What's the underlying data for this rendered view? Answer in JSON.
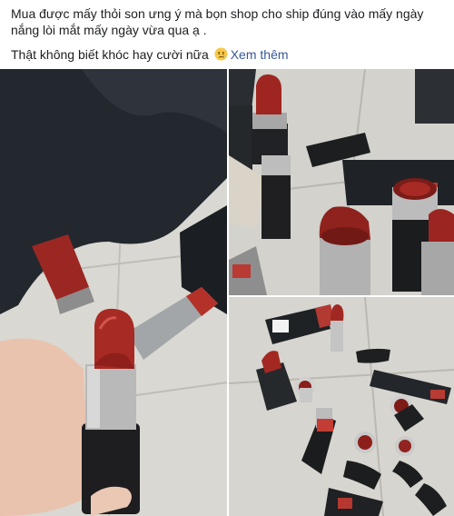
{
  "post": {
    "text_line_1": "Mua được mấy thỏi son ưng ý mà bọn shop cho ship đúng vào mấy ngày nắng lòi mắt mấy ngày vừa qua ạ .",
    "text_line_2": "Thật không biết khóc hay cười nữa",
    "emoji": "sad-tear-emoji",
    "see_more": "Xem thêm"
  },
  "colors": {
    "text": "#1c1e21",
    "link": "#385898",
    "lipstick": "#a82a24",
    "tube": "#222222",
    "floor": "#dcdcd6"
  },
  "gallery": {
    "photos": [
      {
        "name": "photo-1",
        "subject": "hand holding melted red lipstick"
      },
      {
        "name": "photo-2",
        "subject": "lipsticks and boxes on tiled floor"
      },
      {
        "name": "photo-3",
        "subject": "several opened lipsticks on tiled floor"
      }
    ]
  }
}
